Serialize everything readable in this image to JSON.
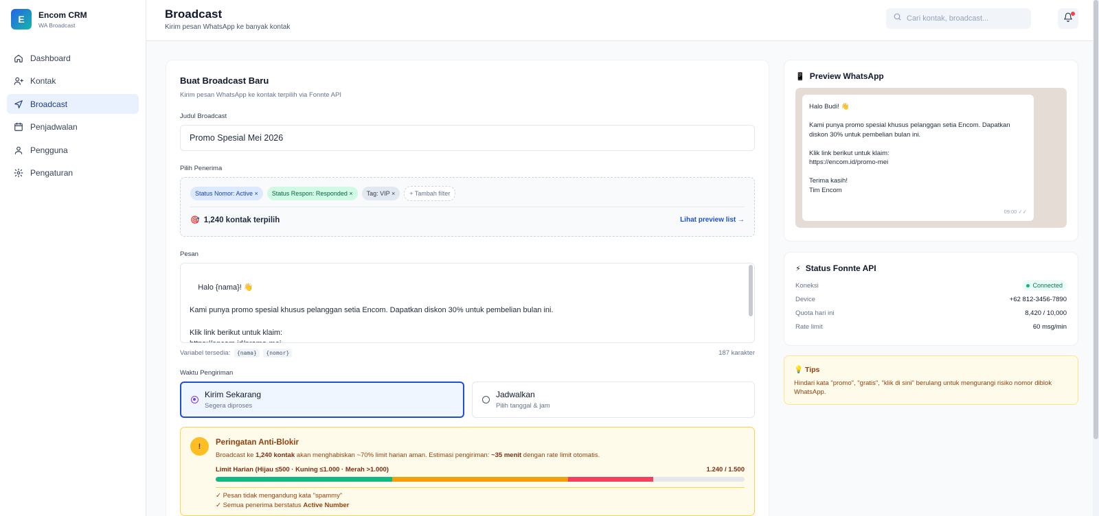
{
  "brand": {
    "logo_letter": "E",
    "name": "Encom CRM",
    "subtitle": "WA Broadcast"
  },
  "sidebar": {
    "items": [
      {
        "label": "Dashboard",
        "icon": "home-icon",
        "active": false
      },
      {
        "label": "Kontak",
        "icon": "users-icon",
        "active": false
      },
      {
        "label": "Broadcast",
        "icon": "send-icon",
        "active": true
      },
      {
        "label": "Penjadwalan",
        "icon": "calendar-icon",
        "active": false
      },
      {
        "label": "Pengguna",
        "icon": "user-icon",
        "active": false
      },
      {
        "label": "Pengaturan",
        "icon": "gear-icon",
        "active": false
      }
    ]
  },
  "header": {
    "title": "Broadcast",
    "subtitle": "Kirim pesan WhatsApp ke banyak kontak",
    "search_placeholder": "Cari kontak, broadcast...",
    "has_notification": true
  },
  "form": {
    "title": "Buat Broadcast Baru",
    "subtitle": "Kirim pesan WhatsApp ke kontak terpilih via Fonnte API",
    "title_label": "Judul Broadcast",
    "title_value": "Promo Spesial Mei 2026",
    "recipients_label": "Pilih Penerima",
    "filters": [
      {
        "label": "Status Nomor: Active ×",
        "color": "blue"
      },
      {
        "label": "Status Respon: Responded ×",
        "color": "green"
      },
      {
        "label": "Tag: VIP ×",
        "color": "gray"
      }
    ],
    "add_filter": "+ Tambah filter",
    "selected_count_emoji": "🎯",
    "selected_count": "1,240 kontak terpilih",
    "preview_link": "Lihat preview list →",
    "message_label": "Pesan",
    "message": "Halo {nama}! 👋\n\nKami punya promo spesial khusus pelanggan setia Encom. Dapatkan diskon 30% untuk pembelian bulan ini.\n\nKlik link berikut untuk klaim:\nhttps://encom.id/promo-mei",
    "variables_label": "Variabel tersedia:",
    "variables": [
      "{nama}",
      "{nomor}"
    ],
    "char_count": "187 karakter",
    "schedule_label": "Waktu Pengiriman",
    "schedule_options": [
      {
        "title": "Kirim Sekarang",
        "sub": "Segera diproses",
        "selected": true
      },
      {
        "title": "Jadwalkan",
        "sub": "Pilih tanggal & jam",
        "selected": false
      }
    ]
  },
  "warning": {
    "icon": "!",
    "title": "Peringatan Anti-Blokir",
    "text_1": "Broadcast ke ",
    "text_bold_1": "1,240 kontak",
    "text_2": " akan menghabiskan ~70% limit harian aman. Estimasi pengiriman: ",
    "text_bold_2": "~35 menit",
    "text_3": " dengan rate limit otomatis.",
    "limit_label": "Limit Harian (Hijau ≤500 · Kuning ≤1.000 · Merah >1.000)",
    "limit_value": "1.240 / 1.500",
    "limit_used": 1240,
    "limit_max": 1500,
    "limit_segments": [
      {
        "upto": 500,
        "color": "#10b981"
      },
      {
        "upto": 1000,
        "color": "#f59e0b"
      },
      {
        "upto": 1240,
        "color": "#f43f5e"
      }
    ],
    "checks": [
      {
        "text": "✓ Pesan tidak mengandung kata \"spammy\"",
        "bold": ""
      },
      {
        "text": "✓ Semua penerima berstatus ",
        "bold": "Active Number"
      }
    ]
  },
  "preview": {
    "icon": "📱",
    "title": "Preview WhatsApp",
    "message": "Halo Budi! 👋\n\nKami punya promo spesial khusus pelanggan setia Encom. Dapatkan diskon 30% untuk pembelian bulan ini.\n\nKlik link berikut untuk klaim:\nhttps://encom.id/promo-mei\n\nTerima kasih!\nTim Encom",
    "time": "09:00 ✓✓"
  },
  "api_status": {
    "icon": "⚡",
    "title": "Status Fonnte API",
    "rows": [
      {
        "key": "Koneksi",
        "value": "Connected",
        "badge": true
      },
      {
        "key": "Device",
        "value": "+62 812-3456-7890",
        "badge": false
      },
      {
        "key": "Quota hari ini",
        "value": "8,420 / 10,000",
        "badge": false
      },
      {
        "key": "Rate limit",
        "value": "60 msg/min",
        "badge": false
      }
    ]
  },
  "tips": {
    "icon": "💡",
    "title": "Tips",
    "text": "Hindari kata \"promo\", \"gratis\", \"klik di sini\" berulang untuk mengurangi risiko nomor diblok WhatsApp."
  }
}
